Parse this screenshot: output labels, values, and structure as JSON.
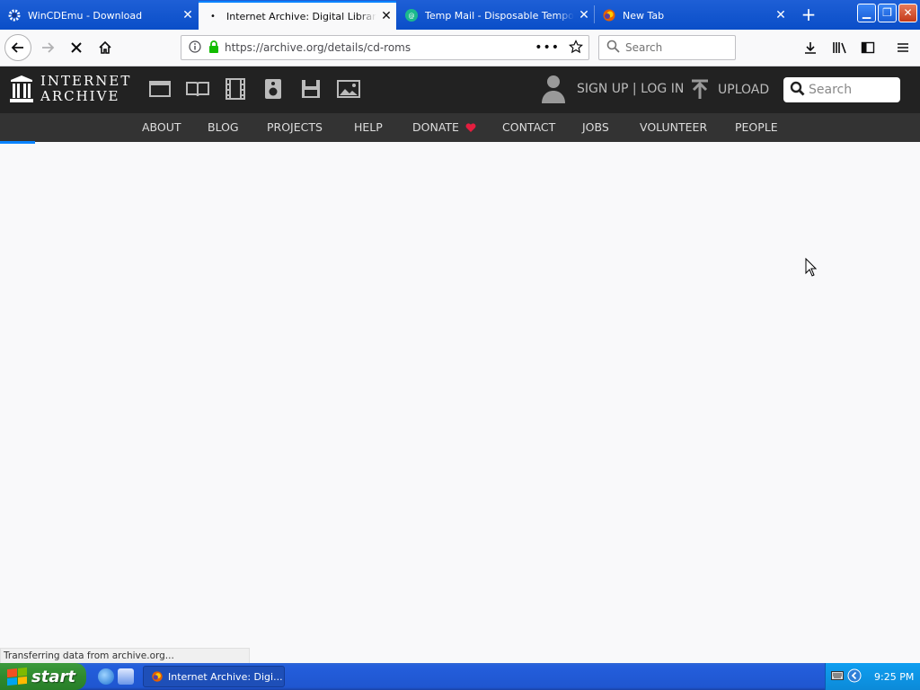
{
  "browser": {
    "tabs": [
      {
        "title": "WinCDEmu - Download",
        "active": false,
        "icon": "gear-icon"
      },
      {
        "title": "Internet Archive: Digital Library of",
        "active": true,
        "icon": "dot-icon"
      },
      {
        "title": "Temp Mail - Disposable Temporary",
        "active": false,
        "icon": "tempmail-icon"
      },
      {
        "title": "New Tab",
        "active": false,
        "icon": "firefox-icon"
      }
    ],
    "url": "https://archive.org/details/cd-roms",
    "search_placeholder": "Search",
    "status_text": "Transferring data from archive.org..."
  },
  "ia": {
    "logo_line1": "INTERNET",
    "logo_line2": "ARCHIVE",
    "signup_login": "SIGN UP | LOG IN",
    "upload": "UPLOAD",
    "search_placeholder": "Search",
    "nav": [
      "ABOUT",
      "BLOG",
      "PROJECTS",
      "HELP",
      "DONATE",
      "CONTACT",
      "JOBS",
      "VOLUNTEER",
      "PEOPLE"
    ],
    "donate_heart_color": "#e41e3f"
  },
  "taskbar": {
    "start_label": "start",
    "active_window": "Internet Archive: Digi...",
    "clock": "9:25 PM"
  },
  "colors": {
    "tabstrip": "#0a4ec8",
    "ia_header": "#222222",
    "ia_nav": "#333333",
    "accent": "#0a84ff"
  }
}
